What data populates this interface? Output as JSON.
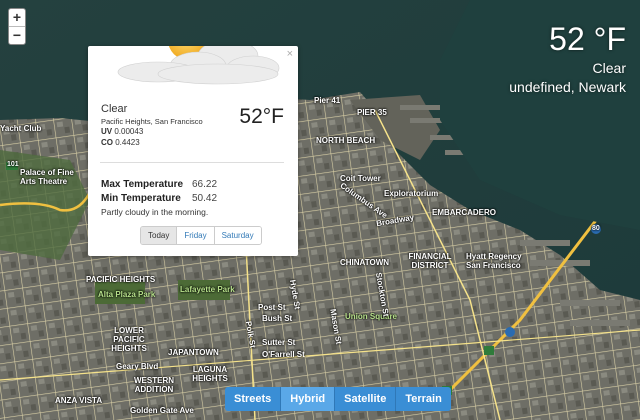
{
  "zoom": {
    "in_label": "+",
    "out_label": "−"
  },
  "current": {
    "temperature": "52 °F",
    "condition": "Clear",
    "location": "undefined, Newark"
  },
  "popup": {
    "icon": "partly-cloudy-icon",
    "close_label": "×",
    "condition": "Clear",
    "place": "Pacific Heights, San Francisco",
    "uv_label": "UV",
    "uv_value": "0.00043",
    "co_label": "CO",
    "co_value": "0.4423",
    "temperature": "52°F",
    "max_label": "Max Temperature",
    "max_value": "66.22",
    "min_label": "Min Temperature",
    "min_value": "50.42",
    "summary": "Partly cloudy in the morning.",
    "tabs": [
      "Today",
      "Friday",
      "Saturday"
    ]
  },
  "map_types": [
    "Streets",
    "Hybrid",
    "Satellite",
    "Terrain"
  ],
  "map_type_active": "Hybrid",
  "map_labels": [
    "Pier 41",
    "PIER 35",
    "NORTH BEACH",
    "Coit Tower",
    "Exploratorium",
    "EMBARCADERO",
    "Broadway",
    "Columbus Ave",
    "CHINATOWN",
    "FINANCIAL DISTRICT",
    "Hyatt Regency San Francisco",
    "PACIFIC HEIGHTS",
    "Alta Plaza Park",
    "Lafayette Park",
    "LOWER PACIFIC HEIGHTS",
    "JAPANTOWN",
    "WESTERN ADDITION",
    "LAGUNA HEIGHTS",
    "Union Square",
    "ANZA VISTA",
    "Golden Gate Ave",
    "Geary Blvd",
    "Bush St",
    "Sutter St",
    "O'Farrell St",
    "Palace of Fine Arts Theatre",
    "Yacht Club",
    "80",
    "101",
    "Post St",
    "Hyde St",
    "Polk St",
    "Mason St",
    "Stockton St"
  ]
}
